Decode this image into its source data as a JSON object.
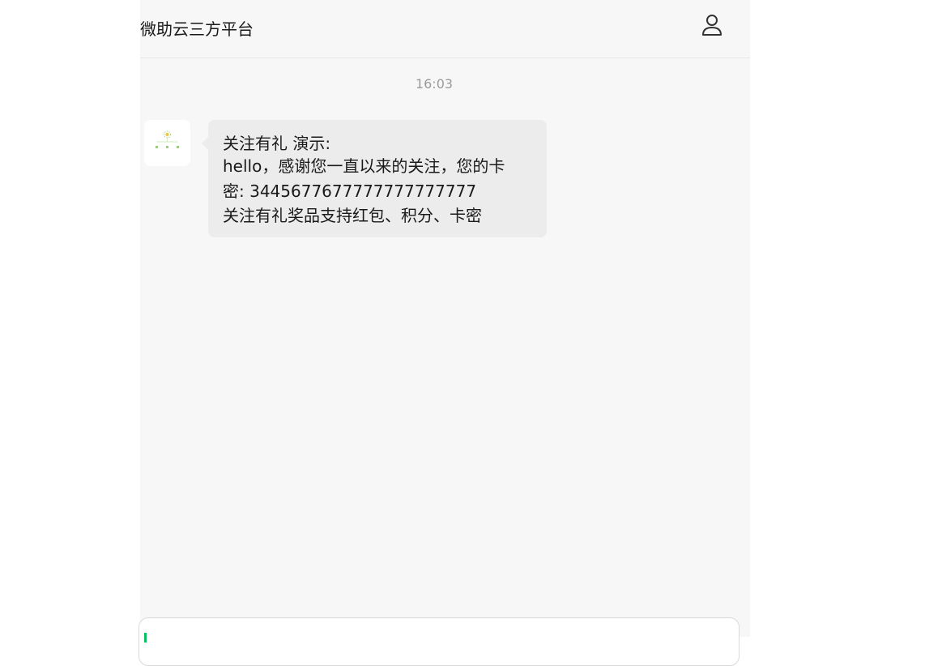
{
  "header": {
    "title": "微助云三方平台",
    "user_icon": "user-icon"
  },
  "chat": {
    "timestamp": "16:03",
    "messages": [
      {
        "sender_avatar": "bot-avatar-icon",
        "lines": [
          "关注有礼 演示:",
          "hello，感谢您一直以来的关注，您的卡",
          "密: 3445677677777777777777",
          "关注有礼奖品支持红包、积分、卡密"
        ]
      }
    ]
  },
  "composer": {
    "value": ""
  },
  "colors": {
    "accent": "#07c160",
    "bubble": "#ececec",
    "background": "#f7f7f7"
  }
}
